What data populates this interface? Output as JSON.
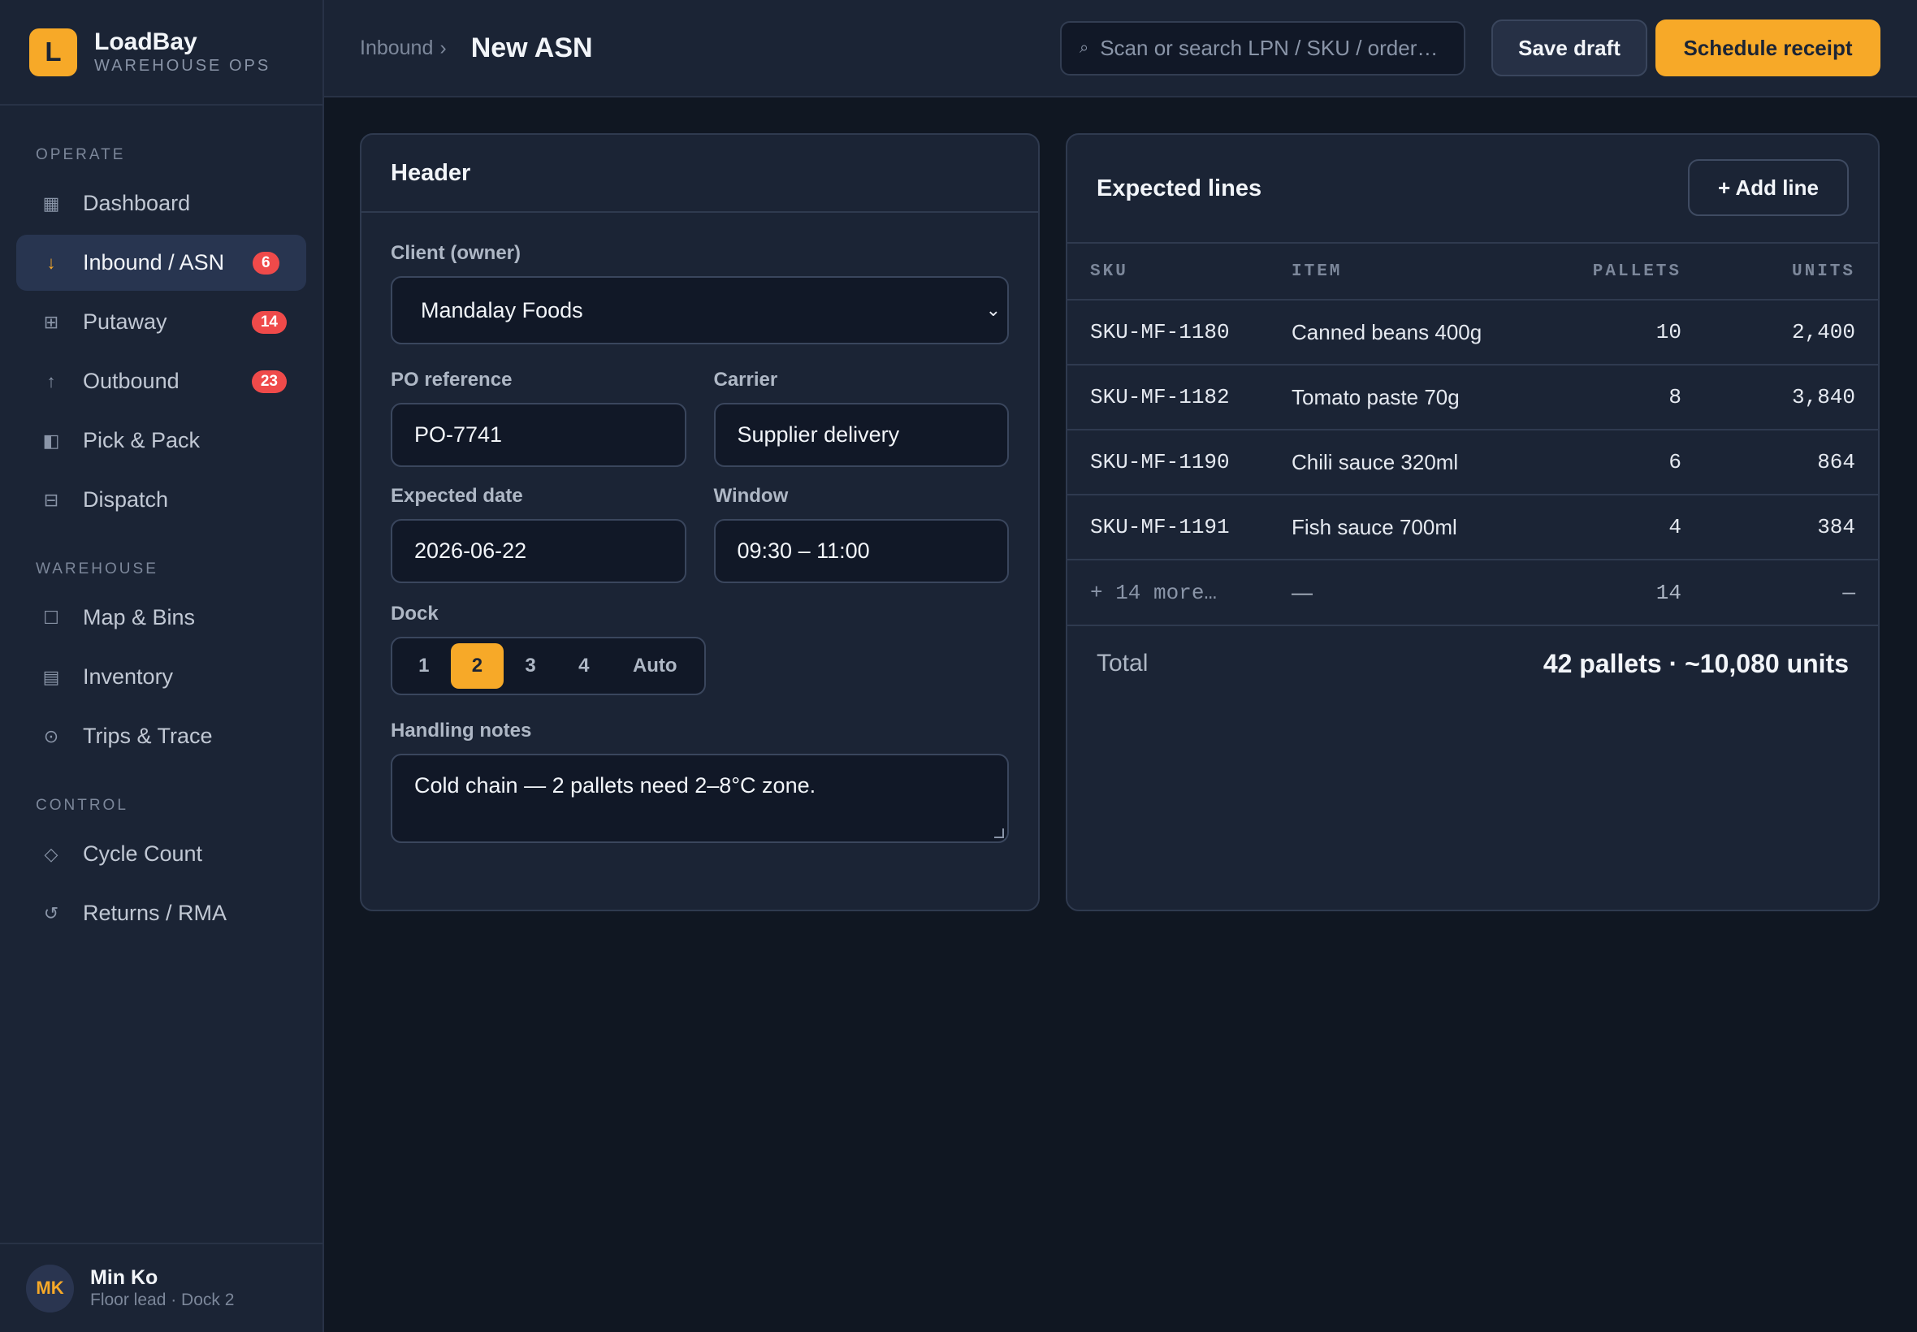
{
  "brand": {
    "initial": "L",
    "name": "LoadBay",
    "subtitle": "WAREHOUSE OPS"
  },
  "sidebar": {
    "sections": [
      {
        "label": "OPERATE"
      },
      {
        "label": "WAREHOUSE"
      },
      {
        "label": "CONTROL"
      }
    ],
    "items": [
      {
        "label": "Dashboard",
        "icon": "dashboard-icon",
        "glyph": "▦"
      },
      {
        "label": "Inbound / ASN",
        "icon": "arrow-down-icon",
        "glyph": "↓",
        "badge": "6",
        "active": true
      },
      {
        "label": "Putaway",
        "icon": "grid-icon",
        "glyph": "⊞",
        "badge": "14"
      },
      {
        "label": "Outbound",
        "icon": "arrow-up-icon",
        "glyph": "↑",
        "badge": "23"
      },
      {
        "label": "Pick & Pack",
        "icon": "box-half-icon",
        "glyph": "◧"
      },
      {
        "label": "Dispatch",
        "icon": "truck-icon",
        "glyph": "⊟"
      },
      {
        "label": "Map & Bins",
        "icon": "map-icon",
        "glyph": "☐"
      },
      {
        "label": "Inventory",
        "icon": "inventory-icon",
        "glyph": "▤"
      },
      {
        "label": "Trips & Trace",
        "icon": "target-icon",
        "glyph": "⊙"
      },
      {
        "label": "Cycle Count",
        "icon": "diamond-icon",
        "glyph": "◇"
      },
      {
        "label": "Returns / RMA",
        "icon": "return-icon",
        "glyph": "↺"
      }
    ]
  },
  "user": {
    "initials": "MK",
    "name": "Min Ko",
    "role": "Floor lead · Dock 2"
  },
  "topbar": {
    "breadcrumb": "Inbound",
    "breadcrumb_sep": "›",
    "title": "New ASN",
    "search_placeholder": "Scan or search LPN / SKU / order…",
    "save_label": "Save draft",
    "primary_label": "Schedule receipt"
  },
  "header_card": {
    "title": "Header",
    "client_label": "Client (owner)",
    "client_value": "Mandalay Foods",
    "po_label": "PO reference",
    "po_value": "PO-7741",
    "carrier_label": "Carrier",
    "carrier_value": "Supplier delivery",
    "date_label": "Expected date",
    "date_value": "2026-06-22",
    "window_label": "Window",
    "window_value": "09:30 – 11:00",
    "dock_label": "Dock",
    "dock_options": [
      "1",
      "2",
      "3",
      "4",
      "Auto"
    ],
    "dock_selected": "2",
    "notes_label": "Handling notes",
    "notes_value": "Cold chain — 2 pallets need 2–8°C zone."
  },
  "lines_card": {
    "title": "Expected lines",
    "add_label": "+ Add line",
    "columns": [
      "SKU",
      "ITEM",
      "PALLETS",
      "UNITS"
    ],
    "rows": [
      {
        "sku": "SKU-MF-1180",
        "item": "Canned beans 400g",
        "pallets": "10",
        "units": "2,400"
      },
      {
        "sku": "SKU-MF-1182",
        "item": "Tomato paste 70g",
        "pallets": "8",
        "units": "3,840"
      },
      {
        "sku": "SKU-MF-1190",
        "item": "Chili sauce 320ml",
        "pallets": "6",
        "units": "864"
      },
      {
        "sku": "SKU-MF-1191",
        "item": "Fish sauce 700ml",
        "pallets": "4",
        "units": "384"
      }
    ],
    "more_row": {
      "sku": "+ 14 more…",
      "item": "—",
      "pallets": "14",
      "units": "—"
    },
    "total_label": "Total",
    "total_value": "42 pallets · ~10,080 units"
  },
  "colors": {
    "accent": "#f7a928",
    "badge": "#ef4a4a",
    "bg": "#101722",
    "panel": "#1b2435"
  }
}
